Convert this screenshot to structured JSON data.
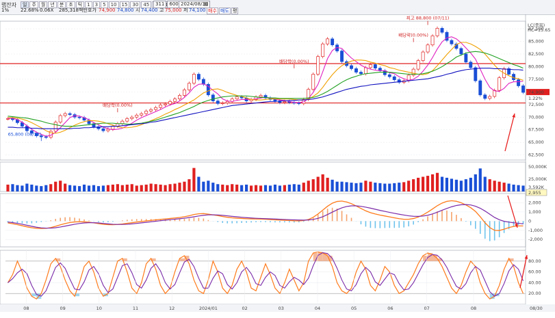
{
  "toolbar": {
    "name": "랩잔자",
    "buttons": [
      "일",
      "주",
      "월",
      "년",
      "분",
      "초",
      "틱",
      "1",
      "3",
      "5",
      "10",
      "15",
      "30",
      "45",
      "60",
      "120",
      "▾"
    ],
    "active": "일",
    "count": "311",
    "count_max": "600",
    "date": "2024/08/30",
    "cal_icon": "calendar-icon"
  },
  "quote": {
    "vol_pct": "1%",
    "rate": "22.68%",
    "x": "0.06X",
    "amount": "285,318백만",
    "call_label": "호가",
    "call": "74,900",
    "call2": "74,800",
    "open_label": "시",
    "open": "74,400",
    "high_label": "고",
    "high": "75,000",
    "low_label": "저",
    "low": "74,100",
    "buy": "매수",
    "sell": "매도",
    "flat": "평"
  },
  "legend_tr": [
    "LC(종목)",
    "HC=15.65"
  ],
  "colors": {
    "up": "#e02020",
    "down": "#1a4fd6",
    "ma5": "#e020c0",
    "ma10": "#f0a000",
    "ma20": "#20a020",
    "ma60": "#1010c0",
    "hline": "#e02020",
    "macd": "#ff7a1a",
    "signal": "#7a2aa8",
    "osc_up": "#f5a26b",
    "osc_dn": "#6ec3ec"
  },
  "chart_data": {
    "type": "line",
    "xaxis_labels": [
      "08",
      "09",
      "10",
      "11",
      "12",
      "2024/01",
      "02",
      "03",
      "04",
      "05",
      "06",
      "07",
      "08",
      "08/30"
    ],
    "price": {
      "ylim": [
        61500,
        89000
      ],
      "ticks": [
        "87,500",
        "85,000",
        "82,500",
        "80,000",
        "77,500",
        "75,000",
        "72,500",
        "70,000",
        "67,500",
        "65,000",
        "62,500"
      ],
      "last": "74,900",
      "last_pct": "1.22%",
      "hlines": [
        80600,
        72800
      ],
      "close": [
        69700,
        69500,
        68900,
        68200,
        67300,
        66800,
        66300,
        66100,
        66000,
        67200,
        69000,
        70300,
        70700,
        70500,
        70000,
        69900,
        69400,
        68700,
        68100,
        67700,
        67300,
        67600,
        68200,
        68700,
        69200,
        69700,
        70000,
        70400,
        70700,
        71200,
        71500,
        71900,
        72400,
        72600,
        73100,
        73600,
        74300,
        75400,
        76700,
        78500,
        77500,
        76500,
        74400,
        73200,
        72700,
        72800,
        73100,
        73600,
        74000,
        73800,
        73200,
        73500,
        74000,
        74300,
        73800,
        73500,
        73200,
        72900,
        73100,
        72900,
        72800,
        72700,
        73500,
        75500,
        78500,
        82000,
        84500,
        85500,
        84300,
        83100,
        81000,
        80200,
        79600,
        78900,
        78600,
        79800,
        80400,
        79700,
        79200,
        78400,
        78000,
        77400,
        76900,
        77200,
        78300,
        79500,
        81200,
        82900,
        84300,
        86100,
        87600,
        86800,
        85200,
        84500,
        83600,
        82500,
        80900,
        79800,
        77200,
        74400,
        73700,
        74100,
        75300,
        77800,
        79600,
        78500,
        77400,
        76200,
        74900
      ],
      "series": [
        {
          "name": "MA5",
          "values": [
            69700,
            69800,
            69500,
            69000,
            68300,
            67600,
            67000,
            66600,
            66200,
            66400,
            67000,
            67900,
            68900,
            69900,
            70300,
            70200,
            69900,
            69500,
            68900,
            68500,
            68000,
            67700,
            67500,
            67600,
            67800,
            68300,
            68800,
            69400,
            69900,
            70300,
            70700,
            71100,
            71500,
            72000,
            72400,
            72700,
            73200,
            73900,
            74800,
            75900,
            76500,
            76600,
            76100,
            75300,
            74600,
            73600,
            73200,
            73100,
            73300,
            73500,
            73500,
            73500,
            73600,
            73800,
            73900,
            73800,
            73600,
            73400,
            73300,
            73100,
            72900,
            72900,
            73000,
            73700,
            74900,
            76500,
            79000,
            81600,
            83200,
            83800,
            83600,
            82600,
            81700,
            81000,
            80300,
            79800,
            79500,
            79300,
            79200,
            79200,
            78800,
            78600,
            78000,
            77600,
            77300,
            77500,
            78100,
            79100,
            80300,
            81800,
            83500,
            84900,
            85700,
            85900,
            85500,
            84700,
            83700,
            82700,
            81500,
            79500,
            77500,
            75900,
            75200,
            75100,
            75700,
            76700,
            77000,
            77000,
            77100
          ]
        },
        {
          "name": "MA10",
          "values": [
            69900,
            69900,
            69800,
            69600,
            69300,
            68900,
            68400,
            67900,
            67300,
            66900,
            66800,
            67000,
            67400,
            67900,
            68400,
            68800,
            69100,
            69300,
            69300,
            69200,
            69000,
            68700,
            68400,
            68100,
            67900,
            67900,
            68000,
            68200,
            68500,
            68900,
            69300,
            69700,
            70100,
            70600,
            71000,
            71500,
            71900,
            72400,
            72900,
            73400,
            74100,
            74800,
            75200,
            75500,
            75600,
            75300,
            74900,
            74600,
            74300,
            74100,
            73800,
            73500,
            73400,
            73400,
            73500,
            73600,
            73600,
            73600,
            73600,
            73600,
            73500,
            73400,
            73400,
            73600,
            74100,
            74800,
            75900,
            77200,
            78400,
            79400,
            80200,
            80700,
            81100,
            81300,
            81300,
            81200,
            80900,
            80700,
            80400,
            80200,
            79800,
            79600,
            79300,
            79100,
            78900,
            78700,
            78500,
            78400,
            78600,
            79200,
            80200,
            81300,
            82400,
            83400,
            84400,
            84800,
            84800,
            84500,
            84000,
            83400,
            82500,
            81400,
            80300,
            79300,
            78700,
            78200,
            77800,
            77600,
            77300
          ]
        },
        {
          "name": "MA20",
          "values": [
            70200,
            70100,
            70000,
            69900,
            69800,
            69600,
            69400,
            69200,
            68900,
            68700,
            68500,
            68300,
            68200,
            68200,
            68200,
            68300,
            68400,
            68500,
            68600,
            68700,
            68800,
            68800,
            68800,
            68700,
            68700,
            68600,
            68600,
            68700,
            68800,
            69000,
            69200,
            69400,
            69700,
            70000,
            70300,
            70600,
            70900,
            71300,
            71700,
            72100,
            72600,
            73000,
            73300,
            73600,
            73800,
            74000,
            74100,
            74200,
            74200,
            74200,
            74200,
            74100,
            74000,
            73900,
            73900,
            73800,
            73800,
            73700,
            73700,
            73700,
            73700,
            73700,
            73700,
            73800,
            73900,
            74200,
            74600,
            75100,
            75700,
            76300,
            76900,
            77400,
            77800,
            78100,
            78400,
            78600,
            78700,
            78800,
            78900,
            78900,
            78900,
            78800,
            78700,
            78600,
            78500,
            78500,
            78500,
            78600,
            78800,
            79100,
            79500,
            80000,
            80600,
            81200,
            81900,
            82300,
            82700,
            82900,
            83000,
            82900,
            82700,
            82400,
            82000,
            81600,
            81200,
            80800,
            80400,
            80100,
            79700
          ]
        },
        {
          "name": "MA60",
          "values": [
            68000,
            68000,
            67900,
            67900,
            67900,
            67800,
            67800,
            67700,
            67700,
            67700,
            67700,
            67700,
            67700,
            67700,
            67800,
            67800,
            67900,
            67900,
            68000,
            68000,
            68100,
            68100,
            68200,
            68200,
            68300,
            68400,
            68500,
            68600,
            68700,
            68800,
            69000,
            69100,
            69300,
            69500,
            69700,
            69900,
            70100,
            70300,
            70500,
            70700,
            70900,
            71100,
            71300,
            71500,
            71700,
            71900,
            72100,
            72300,
            72400,
            72500,
            72600,
            72700,
            72800,
            72900,
            73000,
            73100,
            73100,
            73200,
            73200,
            73300,
            73300,
            73400,
            73400,
            73500,
            73600,
            73800,
            74000,
            74300,
            74600,
            74900,
            75200,
            75500,
            75700,
            75900,
            76100,
            76200,
            76400,
            76500,
            76600,
            76700,
            76800,
            76900,
            77000,
            77100,
            77200,
            77300,
            77400,
            77500,
            77600,
            77800,
            78000,
            78200,
            78500,
            78700,
            79000,
            79200,
            79400,
            79500,
            79600,
            79700,
            79700,
            79700,
            79600,
            79600,
            79500,
            79500,
            79400,
            79400,
            79300
          ]
        }
      ],
      "annotations": [
        {
          "text": "최고 88,800 (07/11)",
          "x": 88,
          "y": 88800
        },
        {
          "text": "65,800 (08/18)",
          "x": 7,
          "y": 65800
        },
        {
          "text": "배당락(0.00%)",
          "x": 60,
          "y": 80200
        },
        {
          "text": "배당락(0.00%)",
          "x": 23,
          "y": 71500
        },
        {
          "text": "배당락(0.00%)",
          "x": 85,
          "y": 85400
        }
      ]
    },
    "volume": {
      "ylim": [
        0,
        60000
      ],
      "ticks": [
        "50,000K",
        "25,000K"
      ],
      "last": "3,592K",
      "values": [
        14000,
        15000,
        13000,
        12000,
        16000,
        14000,
        12000,
        11000,
        13000,
        15000,
        20000,
        22000,
        16000,
        13000,
        12000,
        11000,
        14000,
        12000,
        13000,
        11000,
        12000,
        13000,
        14000,
        15000,
        13000,
        14000,
        15000,
        12000,
        13000,
        14000,
        16000,
        15000,
        14000,
        13000,
        15000,
        16000,
        18000,
        20000,
        25000,
        48000,
        30000,
        20000,
        22000,
        18000,
        15000,
        14000,
        13000,
        15000,
        14000,
        13000,
        14000,
        12000,
        13000,
        12000,
        13000,
        12000,
        14000,
        12000,
        13000,
        14000,
        15000,
        14000,
        18000,
        22000,
        25000,
        30000,
        35000,
        28000,
        24000,
        20000,
        20000,
        19000,
        18000,
        17000,
        18000,
        22000,
        20000,
        18000,
        17000,
        16000,
        16000,
        17000,
        18000,
        19000,
        22000,
        25000,
        28000,
        30000,
        32000,
        35000,
        38000,
        30000,
        28000,
        26000,
        24000,
        22000,
        25000,
        28000,
        35000,
        47000,
        30000,
        25000,
        22000,
        20000,
        18000,
        16000,
        14000,
        13000,
        12000
      ]
    },
    "macd": {
      "ylim": [
        -2800,
        3000
      ],
      "ticks": [
        "2,000",
        "1,000",
        "0",
        "-1,000",
        "-2,000"
      ],
      "last": "2,955",
      "macd": [
        -200,
        -280,
        -380,
        -500,
        -620,
        -720,
        -780,
        -800,
        -780,
        -700,
        -560,
        -400,
        -260,
        -150,
        -90,
        -70,
        -80,
        -120,
        -190,
        -270,
        -340,
        -380,
        -390,
        -360,
        -310,
        -240,
        -170,
        -100,
        -40,
        20,
        80,
        140,
        190,
        240,
        290,
        340,
        400,
        480,
        580,
        720,
        800,
        820,
        760,
        680,
        600,
        500,
        420,
        360,
        320,
        290,
        260,
        240,
        230,
        220,
        200,
        170,
        140,
        110,
        90,
        70,
        40,
        30,
        60,
        180,
        420,
        780,
        1200,
        1620,
        1950,
        2140,
        2180,
        2080,
        1900,
        1650,
        1380,
        1120,
        920,
        780,
        660,
        560,
        460,
        360,
        270,
        200,
        200,
        280,
        440,
        680,
        980,
        1320,
        1680,
        1960,
        2150,
        2220,
        2160,
        2000,
        1760,
        1460,
        1060,
        480,
        -180,
        -700,
        -1000,
        -1020,
        -880,
        -700,
        -580,
        -520,
        -520
      ],
      "signal": [
        -100,
        -160,
        -240,
        -340,
        -450,
        -560,
        -660,
        -730,
        -760,
        -760,
        -720,
        -640,
        -540,
        -440,
        -340,
        -260,
        -200,
        -170,
        -170,
        -200,
        -250,
        -300,
        -340,
        -360,
        -360,
        -340,
        -300,
        -250,
        -190,
        -130,
        -70,
        -10,
        50,
        110,
        160,
        210,
        260,
        320,
        390,
        470,
        560,
        630,
        680,
        690,
        670,
        630,
        580,
        520,
        470,
        420,
        380,
        340,
        310,
        290,
        270,
        250,
        230,
        200,
        180,
        160,
        140,
        120,
        110,
        130,
        190,
        300,
        480,
        720,
        980,
        1230,
        1440,
        1590,
        1660,
        1660,
        1610,
        1520,
        1410,
        1290,
        1170,
        1060,
        950,
        850,
        750,
        660,
        580,
        530,
        520,
        550,
        640,
        780,
        970,
        1180,
        1380,
        1560,
        1700,
        1780,
        1800,
        1760,
        1620,
        1400,
        1100,
        750,
        400,
        150,
        -20,
        -110,
        -180,
        -230,
        -300
      ]
    },
    "stoch": {
      "ylim": [
        0,
        100
      ],
      "ticks": [
        "80.00",
        "60.00",
        "40.00",
        "20.00"
      ],
      "hlines": [
        80,
        20
      ],
      "k": [
        40,
        55,
        80,
        60,
        30,
        15,
        10,
        20,
        45,
        75,
        85,
        70,
        45,
        25,
        15,
        40,
        70,
        80,
        60,
        30,
        15,
        20,
        50,
        80,
        85,
        60,
        30,
        20,
        40,
        75,
        85,
        65,
        35,
        20,
        30,
        60,
        85,
        90,
        75,
        45,
        25,
        20,
        45,
        80,
        60,
        30,
        20,
        35,
        65,
        80,
        60,
        30,
        25,
        50,
        75,
        55,
        30,
        20,
        40,
        65,
        45,
        25,
        40,
        80,
        95,
        97,
        95,
        90,
        70,
        40,
        25,
        20,
        30,
        60,
        80,
        65,
        35,
        25,
        45,
        70,
        60,
        35,
        20,
        25,
        40,
        55,
        75,
        90,
        95,
        92,
        85,
        70,
        50,
        30,
        20,
        35,
        60,
        80,
        70,
        40,
        20,
        10,
        15,
        35,
        65,
        85,
        70,
        40,
        20
      ]
    }
  }
}
